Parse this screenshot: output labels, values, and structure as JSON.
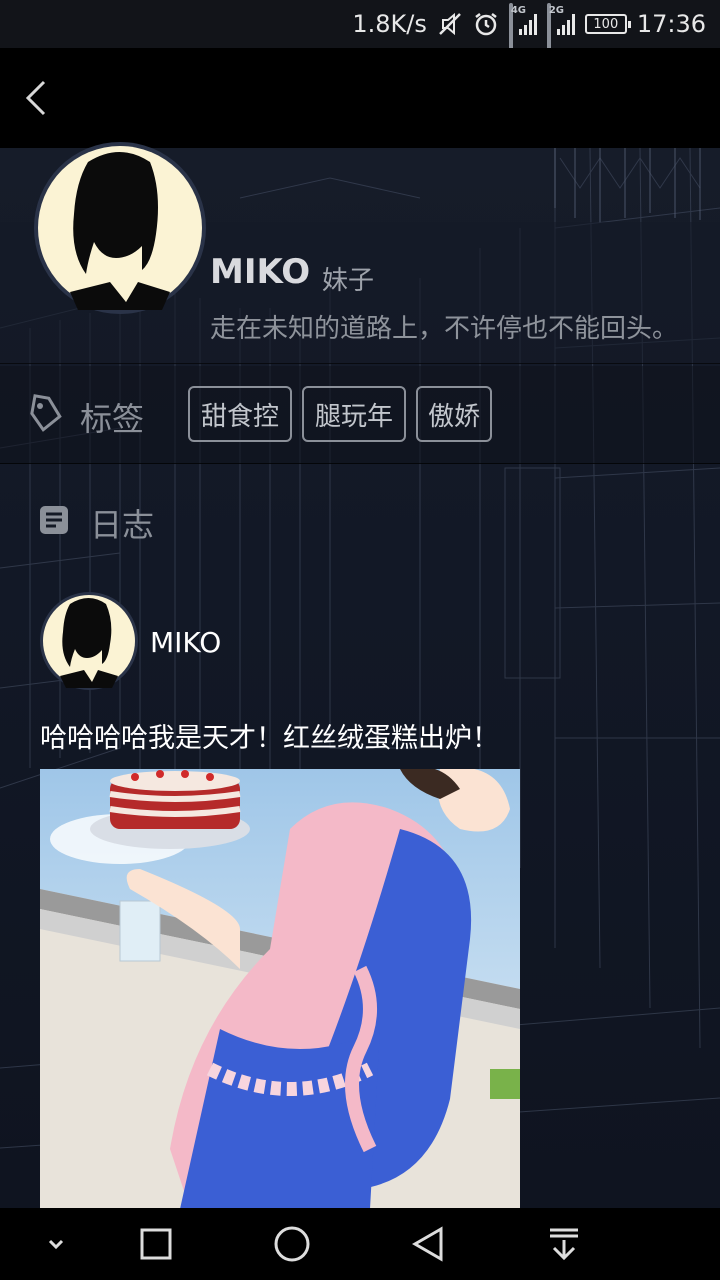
{
  "status_bar": {
    "speed": "1.8K/s",
    "network_1": "4G",
    "network_2": "2G",
    "battery": "100",
    "time": "17:36"
  },
  "profile": {
    "name": "MIKO",
    "gender": "妹子",
    "bio": "走在未知的道路上，不许停也不能回头。"
  },
  "tags": {
    "label": "标签",
    "items": [
      "甜食控",
      "腿玩年",
      "傲娇"
    ]
  },
  "diary": {
    "label": "日志"
  },
  "post": {
    "author": "MIKO",
    "text": "哈哈哈哈我是天才！红丝绒蛋糕出炉！"
  },
  "icons": {
    "back": "chevron-left-icon",
    "tag": "tag-icon",
    "diary": "document-icon",
    "nav": [
      "chevron-down-icon",
      "square-icon",
      "circle-icon",
      "triangle-back-icon",
      "download-icon"
    ]
  },
  "colors": {
    "background": "#0d121c",
    "muted_text": "#8b9099",
    "avatar_bg": "#fbf3d4"
  }
}
